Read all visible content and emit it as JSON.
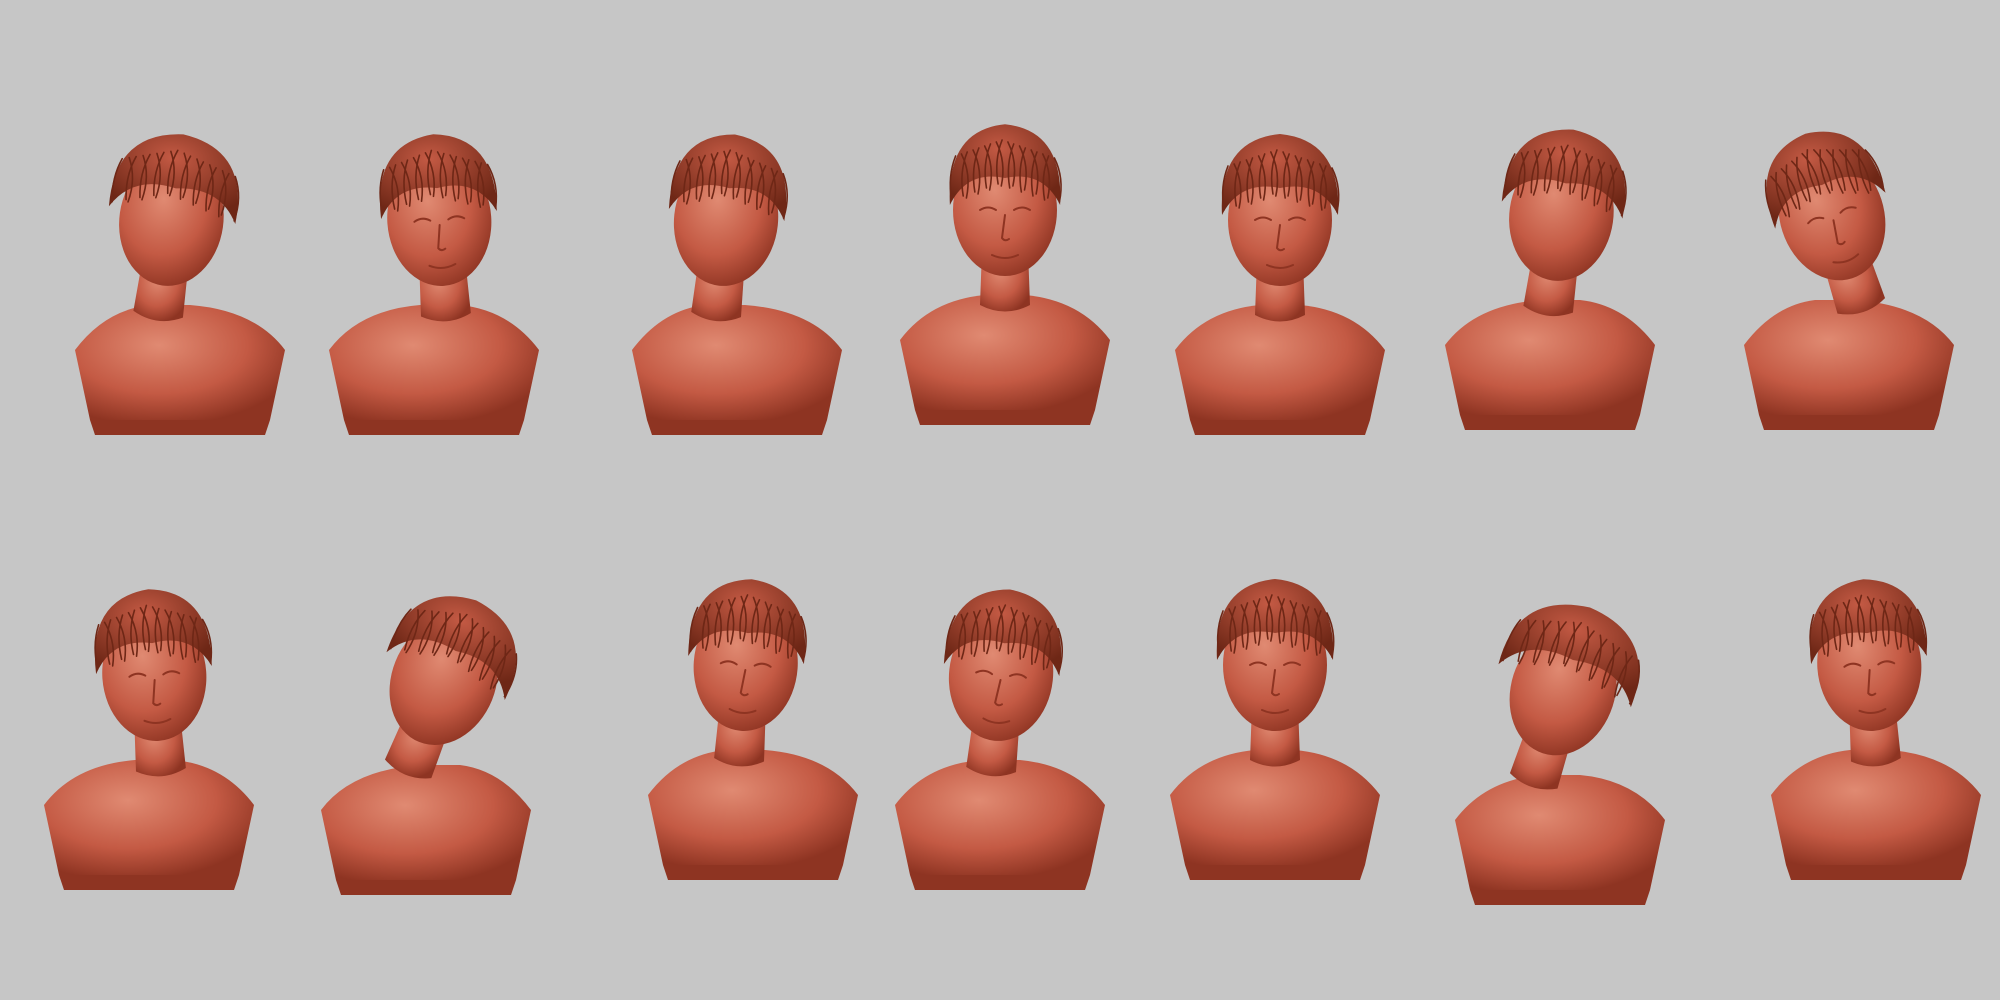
{
  "scene": {
    "background_color": "#c6c6c6",
    "clay_color": "#c45a44",
    "clay_shadow": "#8e3422",
    "clay_highlight": "#e08a72",
    "hair_color": "#a4462f",
    "hair_strand": "#6e2716"
  },
  "busts": [
    {
      "view": "back"
    },
    {
      "view": "front-three-quarter-right"
    },
    {
      "view": "left-profile-back"
    },
    {
      "view": "front-tilted-up"
    },
    {
      "view": "front"
    },
    {
      "view": "right-profile-back"
    },
    {
      "view": "front-tilted-left"
    },
    {
      "view": "front-three-quarter-right"
    },
    {
      "view": "back-three-quarter"
    },
    {
      "view": "three-quarter-left"
    },
    {
      "view": "front-looking-down"
    },
    {
      "view": "front"
    },
    {
      "view": "top-down"
    },
    {
      "view": "three-quarter-left"
    }
  ]
}
